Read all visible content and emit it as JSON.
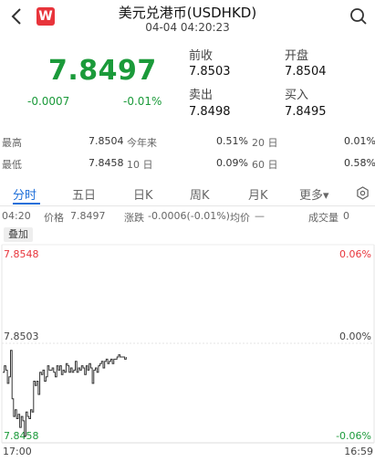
{
  "header": {
    "title": "美元兑港币(USDHKD)",
    "subtitle": "04-04 04:20:23",
    "logo_letter": "W"
  },
  "quote": {
    "price": "7.8497",
    "change": "-0.0007",
    "change_pct": "-0.01%",
    "prev_close_label": "前收",
    "prev_close": "7.8503",
    "open_label": "开盘",
    "open": "7.8504",
    "ask_label": "卖出",
    "ask": "7.8498",
    "bid_label": "买入",
    "bid": "7.8495"
  },
  "stats": {
    "high_label": "最高",
    "high": "7.8504",
    "ytd_label": "今年来",
    "ytd": "0.51%",
    "d20_label": "20 日",
    "d20": "0.01%",
    "low_label": "最低",
    "low": "7.8458",
    "d10_label": "10 日",
    "d10": "0.09%",
    "d60_label": "60 日",
    "d60": "0.58%"
  },
  "tabs": [
    "分时",
    "五日",
    "日K",
    "周K",
    "月K",
    "更多▾"
  ],
  "info": {
    "time": "04:20",
    "price_label": "价格",
    "price": "7.8497",
    "chg_label": "涨跌",
    "chg": "-0.0006(-0.01%)",
    "avg_label": "均价",
    "avg": "—",
    "vol_label": "成交量",
    "vol": "0"
  },
  "overlay_label": "叠加",
  "chart_data": {
    "type": "line",
    "y_left_ticks": [
      "7.8548",
      "7.8503",
      "7.8458"
    ],
    "y_right_ticks": [
      "0.06%",
      "0.00%",
      "-0.06%"
    ],
    "x_ticks": [
      "17:00",
      "16:59"
    ],
    "ylim": [
      7.8458,
      7.8548
    ],
    "x": [
      0,
      1,
      2,
      3,
      4,
      5,
      6,
      7,
      8,
      9,
      10,
      11,
      12,
      13,
      14,
      15,
      16,
      17,
      18,
      19,
      20,
      21,
      22,
      23,
      24,
      25,
      26,
      27,
      28,
      29,
      30,
      31,
      32,
      33,
      34,
      35,
      36,
      37,
      38,
      39,
      40,
      41,
      42,
      43,
      44,
      45,
      46,
      47,
      48,
      49,
      50,
      51,
      52,
      53,
      54,
      55,
      56,
      57,
      58,
      59,
      60,
      61,
      62,
      63,
      64,
      65,
      66,
      67,
      68,
      69,
      70,
      71,
      72,
      73,
      74,
      75,
      76,
      77,
      78,
      79,
      80
    ],
    "values": [
      7.849,
      7.8493,
      7.8491,
      7.8485,
      7.8488,
      7.85,
      7.8478,
      7.847,
      7.8473,
      7.8469,
      7.8471,
      7.8465,
      7.847,
      7.8468,
      7.8461,
      7.8472,
      7.847,
      7.8469,
      7.8473,
      7.8472,
      7.8486,
      7.8484,
      7.8486,
      7.848,
      7.849,
      7.8489,
      7.8491,
      7.8486,
      7.8488,
      7.8493,
      7.8491,
      7.8491,
      7.8492,
      7.849,
      7.8488,
      7.8493,
      7.8491,
      7.8493,
      7.8489,
      7.8491,
      7.849,
      7.8494,
      7.8493,
      7.849,
      7.8492,
      7.849,
      7.8491,
      7.8495,
      7.849,
      7.8492,
      7.8491,
      7.8493,
      7.8492,
      7.8489,
      7.8493,
      7.8491,
      7.8494,
      7.8492,
      7.8485,
      7.8491,
      7.8492,
      7.849,
      7.8493,
      7.8494,
      7.8495,
      7.8492,
      7.8495,
      7.8496,
      7.8494,
      7.8495,
      7.8496,
      7.8494,
      7.8496,
      7.8496,
      7.8497,
      7.8498,
      7.8497,
      7.8497,
      7.8497,
      7.8496,
      7.8497
    ],
    "colors": {
      "line": "#333333",
      "up": "#e8343b",
      "down": "#1b9a3a"
    }
  }
}
